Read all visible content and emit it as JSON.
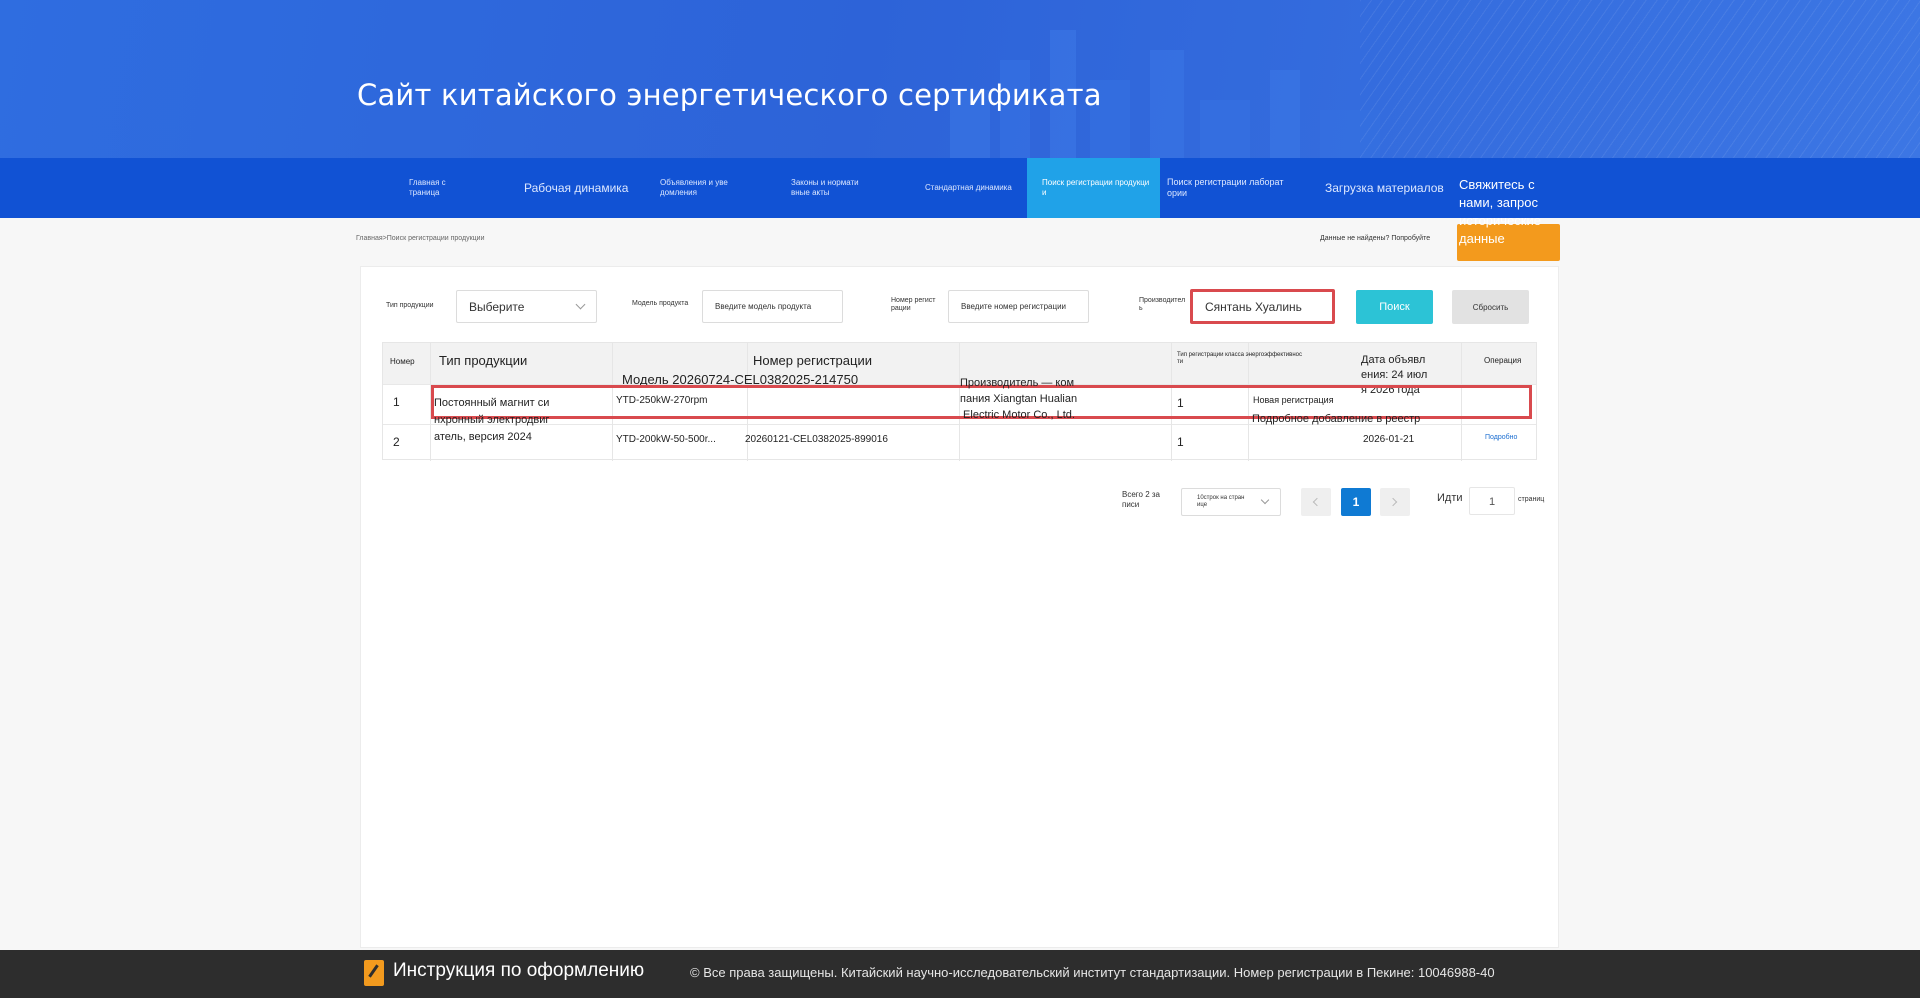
{
  "header": {
    "title": "Сайт китайского энергетического сертификата"
  },
  "nav": {
    "items": [
      {
        "label": "Главная с\nтраница"
      },
      {
        "label": "Рабочая динамика"
      },
      {
        "label": "Объявления и уве\nдомления"
      },
      {
        "label": "Законы и нормати\nвные акты"
      },
      {
        "label": "Стандартная динамика"
      },
      {
        "label": "Поиск регистрации продукци\nи"
      },
      {
        "label": "Поиск регистрации лаборат\nории"
      },
      {
        "label": "Загрузка материалов"
      }
    ],
    "contact_label": "Свяжитесь с нами, запрос исторические данные"
  },
  "breadcrumb": "Главная>Поиск регистрации продукции",
  "not_found_text": "Данные не найдены? Попробуйте",
  "filters": {
    "product_type_label": "Тип продукции",
    "product_type_value": "Выберите",
    "model_label": "Модель продукта",
    "model_placeholder": "Введите модель продукта",
    "reg_label": "Номер регист\nрации",
    "reg_placeholder": "Введите номер регистрации",
    "manufacturer_label": "Производител\nь",
    "manufacturer_value": "Сянтань Хуалинь",
    "search_label": "Поиск",
    "reset_label": "Сбросить"
  },
  "table": {
    "headers": {
      "num": "Номер",
      "type": "Тип продукции",
      "model_overlay": "Модель 20260724-CEL0382025-214750",
      "reg": "Номер регистрации",
      "reg_type": "Тип регистрации класса энергоэффективнос\nти",
      "date": "Дата объявл\nения: 24 июл\nя 2026 года",
      "op": "Операция"
    },
    "rows": [
      {
        "num": "1",
        "type": "Постоянный магнит си\nнхронный электродвиг\nатель, версия 2024",
        "model": "YTD-250kW-270rpm",
        "manufacturer": "Производитель — ком\nпания Xiangtan Hualian\n Electric Motor Co., Ltd.",
        "grade": "1",
        "reg_type": "Новая регистрация",
        "reg_overlay": "Подробное добавление в реестр"
      },
      {
        "num": "2",
        "model": "YTD-200kW-50-500r...",
        "reg_no": "20260121-CEL0382025-899016",
        "grade": "1",
        "date": "2026-01-21",
        "op": "Подробно"
      }
    ]
  },
  "pagination": {
    "total": "Всего 2 за\nписи",
    "per_page": "10строк на стран\nице",
    "current_page": "1",
    "goto_label": "Идти",
    "goto_value": "1",
    "page_suffix": "страниц"
  },
  "footer": {
    "title": "Инструкция по оформлению",
    "copyright": "© Все права защищены. Китайский научно-исследовательский институт стандартизации. Номер регистрации в Пекине: 10046988-40"
  }
}
